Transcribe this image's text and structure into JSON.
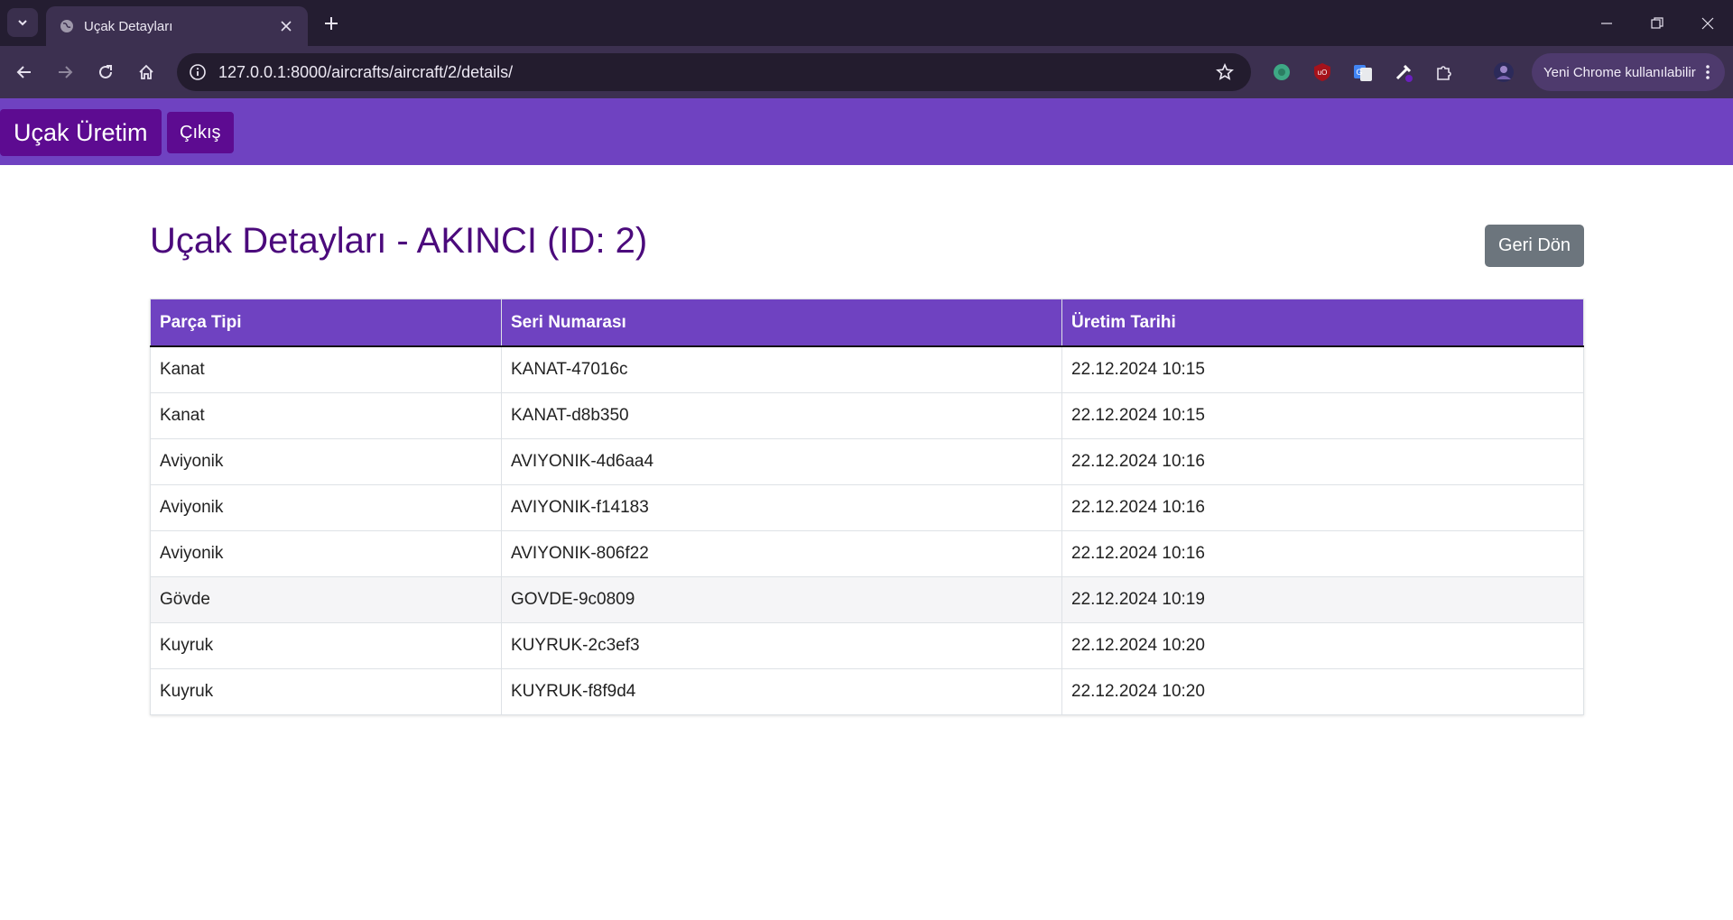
{
  "browser": {
    "tab_title": "Uçak Detayları",
    "url": "127.0.0.1:8000/aircrafts/aircraft/2/details/",
    "profile_label": "Yeni Chrome kullanılabilir"
  },
  "nav": {
    "brand": "Uçak Üretim",
    "logout": "Çıkış"
  },
  "page": {
    "title": "Uçak Detayları - AKINCI (ID: 2)",
    "back_button": "Geri Dön"
  },
  "table": {
    "headers": [
      "Parça Tipi",
      "Seri Numarası",
      "Üretim Tarihi"
    ],
    "rows": [
      [
        "Kanat",
        "KANAT-47016c",
        "22.12.2024 10:15"
      ],
      [
        "Kanat",
        "KANAT-d8b350",
        "22.12.2024 10:15"
      ],
      [
        "Aviyonik",
        "AVIYONIK-4d6aa4",
        "22.12.2024 10:16"
      ],
      [
        "Aviyonik",
        "AVIYONIK-f14183",
        "22.12.2024 10:16"
      ],
      [
        "Aviyonik",
        "AVIYONIK-806f22",
        "22.12.2024 10:16"
      ],
      [
        "Gövde",
        "GOVDE-9c0809",
        "22.12.2024 10:19"
      ],
      [
        "Kuyruk",
        "KUYRUK-2c3ef3",
        "22.12.2024 10:20"
      ],
      [
        "Kuyruk",
        "KUYRUK-f8f9d4",
        "22.12.2024 10:20"
      ]
    ]
  },
  "colors": {
    "navbar": "#6f42c1",
    "brand_bg": "#5d0b91",
    "heading": "#4b0a7c",
    "back_button": "#6c757d"
  }
}
